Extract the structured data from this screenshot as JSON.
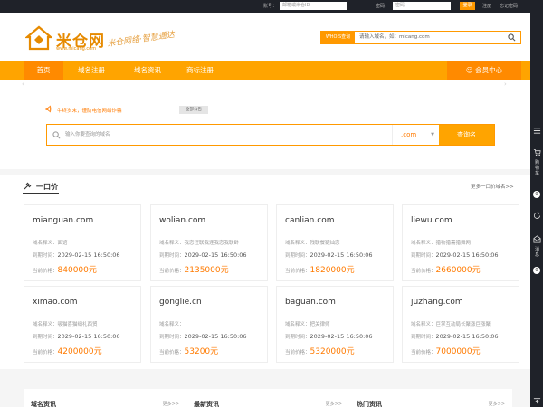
{
  "topbar": {
    "account_label": "账号：",
    "account_placeholder": "邮箱或米仓ID",
    "password_label": "密码：",
    "password_placeholder": "密码",
    "login_label": "登录",
    "register_label": "注册",
    "forgot_label": "忘记密码"
  },
  "header": {
    "logo_text": "米仓网",
    "logo_url": "www.micang.com",
    "slogan": "米仓网络·智慧通达",
    "whois_tag": "WHOIS查询",
    "whois_placeholder": "请输入域名，如：micang.com"
  },
  "nav": {
    "items": [
      "首页",
      "域名注册",
      "域名资讯",
      "商标注册"
    ],
    "member": "会员中心"
  },
  "notice": {
    "text": "牛终岁末，谨防电信网络诈骗",
    "all_label": "全部公告"
  },
  "search": {
    "placeholder": "输入你要查询的域名",
    "suffix": ".com",
    "button": "查询名"
  },
  "fixed_price": {
    "title": "一口价",
    "more": "更多一口价域名>>",
    "meaning_label": "域名释义：",
    "expire_label": "到期时间：",
    "price_label": "当前价格：",
    "cards": [
      {
        "domain": "mianguan.com",
        "meaning": "面馆",
        "expire": "2029-02-15 16:50:06",
        "price": "840000元"
      },
      {
        "domain": "wolian.com",
        "meaning": "我恋汪联我连我恋我联卧",
        "expire": "2029-02-15 16:50:06",
        "price": "2135000元"
      },
      {
        "domain": "canlian.com",
        "meaning": "残联餐链灿恋",
        "expire": "2029-02-15 16:50:06",
        "price": "1820000元"
      },
      {
        "domain": "liewu.com",
        "meaning": "猎物猎需猎舞网",
        "expire": "2029-02-15 16:50:06",
        "price": "2660000元"
      },
      {
        "domain": "ximao.com",
        "meaning": "吸猫喜猫细礼西贸",
        "expire": "2029-02-15 16:50:06",
        "price": "4200000元"
      },
      {
        "domain": "gonglie.cn",
        "meaning": "",
        "expire": "2029-02-15 16:50:06",
        "price": "53200元"
      },
      {
        "domain": "baguan.com",
        "meaning": "把关律师",
        "expire": "2029-02-15 16:50:06",
        "price": "5320000元"
      },
      {
        "domain": "juzhang.com",
        "meaning": "巨掌互动局长聚涨巨涨聚",
        "expire": "2029-02-15 16:50:06",
        "price": "7000000元"
      }
    ]
  },
  "bottom": {
    "panels": [
      {
        "title": "域名资讯",
        "more": "更多>>"
      },
      {
        "title": "最新资讯",
        "more": "更多>>"
      },
      {
        "title": "热门资讯",
        "more": "更多>>"
      }
    ]
  },
  "sidebar": {
    "cart_label": "购物车",
    "cart_count": "0",
    "msg_label": "消息",
    "msg_count": "0"
  },
  "colors": {
    "brand_orange": "#ffa400",
    "accent_orange": "#ff7a00",
    "dark_bar": "#1f2229"
  }
}
